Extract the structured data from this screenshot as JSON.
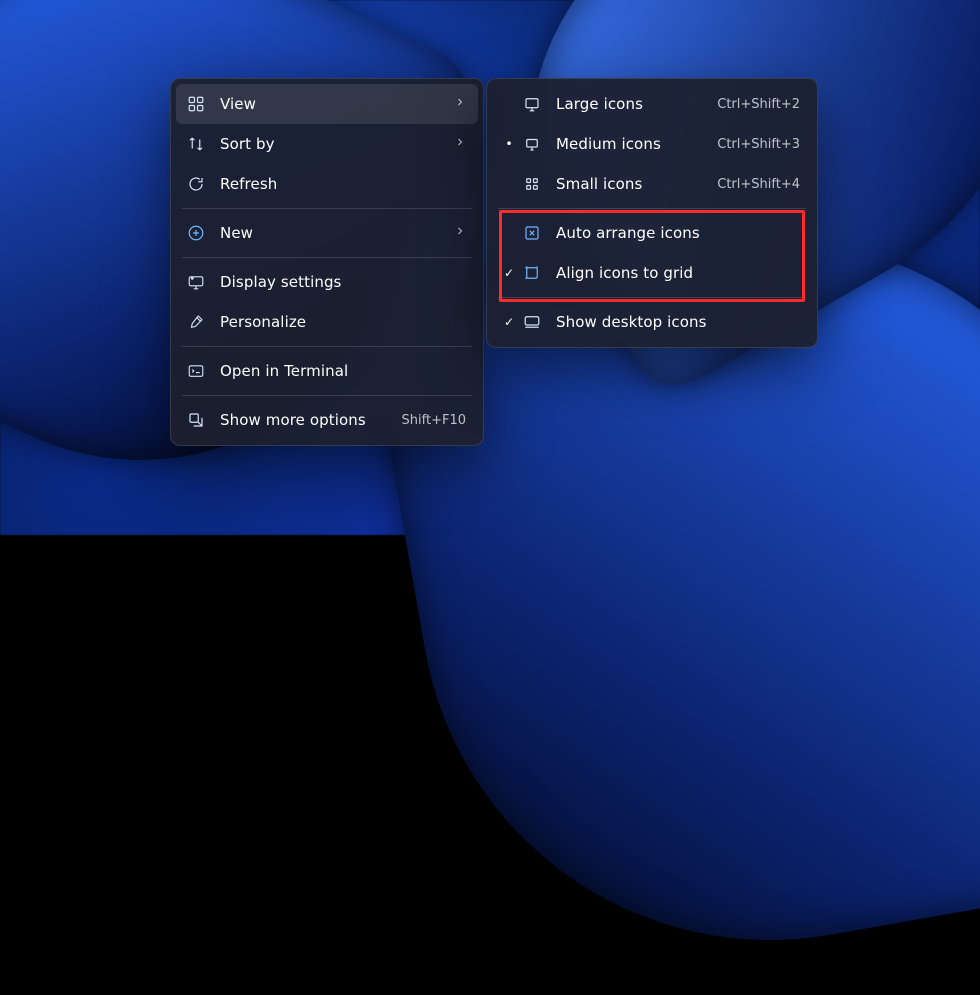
{
  "primary": {
    "view": {
      "label": "View",
      "hint": "",
      "submenu": true,
      "highlight": true
    },
    "sort": {
      "label": "Sort by",
      "hint": "",
      "submenu": true
    },
    "refresh": {
      "label": "Refresh",
      "hint": ""
    },
    "new": {
      "label": "New",
      "hint": "",
      "submenu": true
    },
    "display": {
      "label": "Display settings",
      "hint": ""
    },
    "personalize": {
      "label": "Personalize",
      "hint": ""
    },
    "terminal": {
      "label": "Open in Terminal",
      "hint": ""
    },
    "more": {
      "label": "Show more options",
      "hint": "Shift+F10"
    }
  },
  "submenu": {
    "large": {
      "label": "Large icons",
      "hint": "Ctrl+Shift+2",
      "mark": ""
    },
    "medium": {
      "label": "Medium icons",
      "hint": "Ctrl+Shift+3",
      "mark": "•"
    },
    "small": {
      "label": "Small icons",
      "hint": "Ctrl+Shift+4",
      "mark": ""
    },
    "auto": {
      "label": "Auto arrange icons",
      "hint": "",
      "mark": ""
    },
    "align": {
      "label": "Align icons to grid",
      "hint": "",
      "mark": "✓"
    },
    "show": {
      "label": "Show desktop icons",
      "hint": "",
      "mark": "✓"
    }
  },
  "highlight_box_note": "red annotation around Auto arrange + Align items"
}
